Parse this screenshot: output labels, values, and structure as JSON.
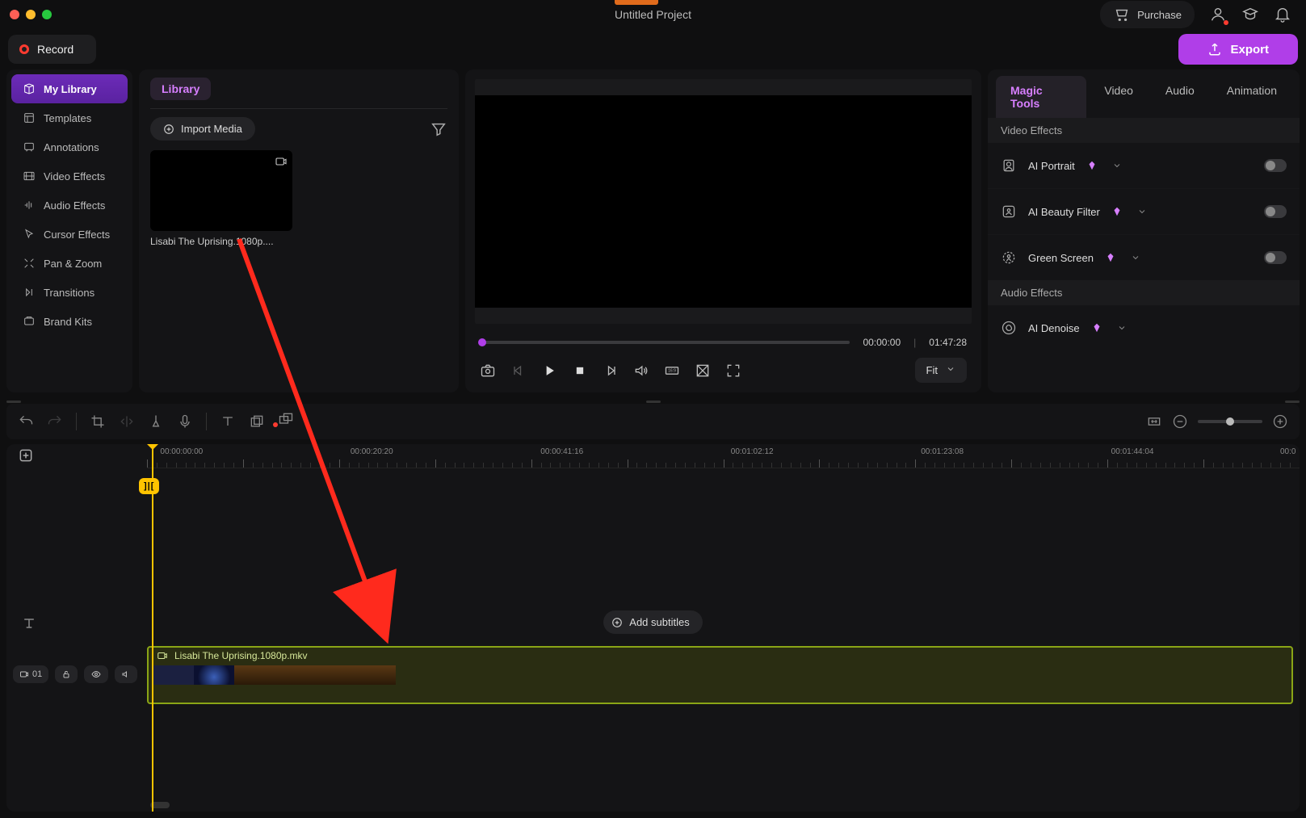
{
  "project_title": "Untitled Project",
  "purchase_label": "Purchase",
  "record_label": "Record",
  "export_label": "Export",
  "leftnav": [
    {
      "label": "My Library",
      "active": true
    },
    {
      "label": "Templates"
    },
    {
      "label": "Annotations"
    },
    {
      "label": "Video Effects"
    },
    {
      "label": "Audio Effects"
    },
    {
      "label": "Cursor Effects"
    },
    {
      "label": "Pan & Zoom"
    },
    {
      "label": "Transitions"
    },
    {
      "label": "Brand Kits"
    }
  ],
  "library": {
    "tab_label": "Library",
    "import_label": "Import Media",
    "clip_name": "Lisabi The Uprising.1080p...."
  },
  "preview": {
    "current_time": "00:00:00",
    "total_time": "01:47:28",
    "fit_label": "Fit"
  },
  "prop_tabs": [
    "Magic Tools",
    "Video",
    "Audio",
    "Animation"
  ],
  "prop_sections": {
    "video_effects_title": "Video Effects",
    "audio_effects_title": "Audio Effects",
    "rows": [
      {
        "label": "AI Portrait"
      },
      {
        "label": "AI Beauty Filter"
      },
      {
        "label": "Green Screen"
      },
      {
        "label": "AI Denoise"
      }
    ]
  },
  "ruler_labels": [
    "00:00:00:00",
    "00:00:20:20",
    "00:00:41:16",
    "00:01:02:12",
    "00:01:23:08",
    "00:01:44:04",
    "00:0"
  ],
  "split_badge": "]|[",
  "add_subtitles_label": "Add subtitles",
  "video_clip_label": "Lisabi The Uprising.1080p.mkv",
  "track_number": "01"
}
